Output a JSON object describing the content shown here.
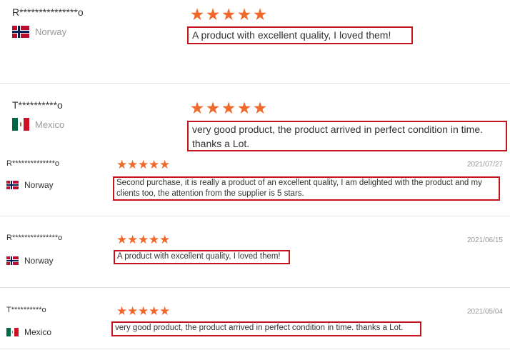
{
  "reviews": [
    {
      "name": "R***************o",
      "country": "Norway",
      "flag": "norway-flag",
      "stars": 5,
      "date": "",
      "comment": "A product with excellent quality, I loved them!"
    },
    {
      "name": "T**********o",
      "country": "Mexico",
      "flag": "mexico-flag",
      "stars": 5,
      "date": "",
      "comment": "very good product, the product arrived in perfect condition in time. thanks a Lot."
    },
    {
      "name": "R**************o",
      "country": "Norway",
      "flag": "norway-flag",
      "stars": 5,
      "date": "2021/07/27",
      "comment": "Second purchase, it is really a product of an excellent quality, I am delighted with the product and my clients too, the attention from the supplier is 5 stars."
    },
    {
      "name": "R***************o",
      "country": "Norway",
      "flag": "norway-flag",
      "stars": 5,
      "date": "2021/06/15",
      "comment": "A product with excellent quality, I loved them!"
    },
    {
      "name": "T**********o",
      "country": "Mexico",
      "flag": "mexico-flag",
      "stars": 5,
      "date": "2021/05/04",
      "comment": "very good product, the product arrived in perfect condition in time. thanks a Lot."
    }
  ],
  "colors": {
    "star": "#f0692a",
    "highlight_border": "#c3141c",
    "muted_text": "#999999"
  }
}
